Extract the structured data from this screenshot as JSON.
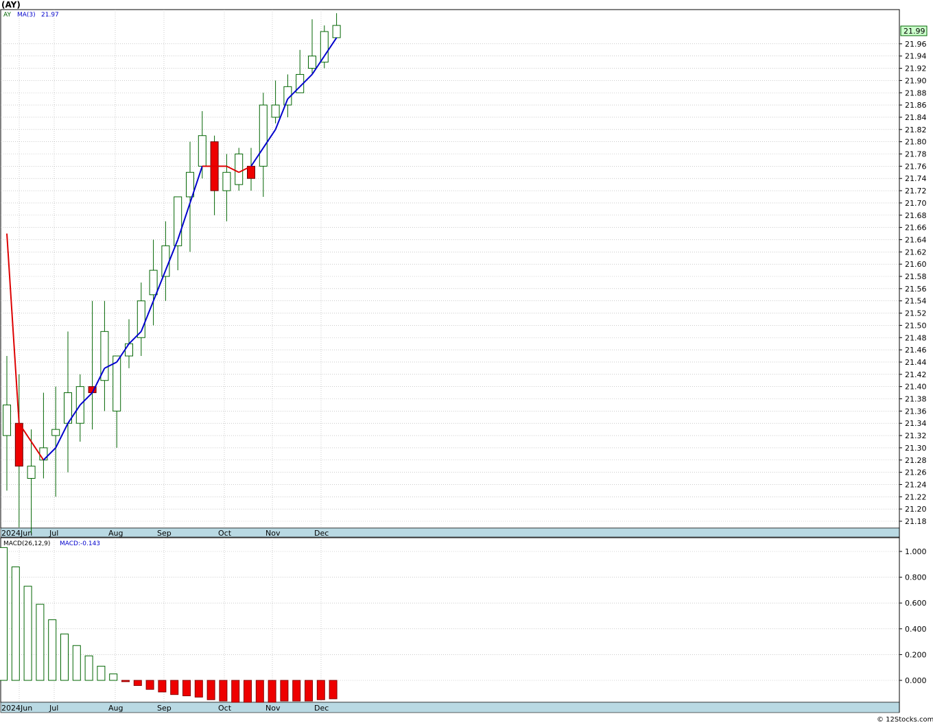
{
  "header": {
    "symbol_title": "(AY)",
    "legend_symbol": "AY",
    "legend_ma_label": "MA(3)",
    "legend_ma_value": "21.97",
    "last_price_tag": "21.99",
    "footer_credit": "© 12Stocks.com"
  },
  "macd_panel": {
    "label": "MACD(26,12,9)",
    "value_label": "MACD:-0.143"
  },
  "x_axis_labels": [
    "2024Jun",
    "Jul",
    "Aug",
    "Sep",
    "Oct",
    "Nov",
    "Dec"
  ],
  "colors": {
    "up_candle_edge": "#006400",
    "down_candle_fill": "#ee0000",
    "ma_up": "#0000cc",
    "ma_down": "#dd0000",
    "axis_band": "#b9d9e3",
    "grid": "#aaaaaa"
  },
  "chart_data": [
    {
      "type": "candlestick",
      "title": "(AY)",
      "ylim": [
        21.16,
        22.02
      ],
      "y_ticks": [
        "21.18",
        "21.20",
        "21.22",
        "21.24",
        "21.26",
        "21.28",
        "21.30",
        "21.32",
        "21.34",
        "21.36",
        "21.38",
        "21.40",
        "21.42",
        "21.44",
        "21.46",
        "21.48",
        "21.50",
        "21.52",
        "21.54",
        "21.56",
        "21.58",
        "21.60",
        "21.62",
        "21.64",
        "21.66",
        "21.68",
        "21.70",
        "21.72",
        "21.74",
        "21.76",
        "21.78",
        "21.80",
        "21.82",
        "21.84",
        "21.86",
        "21.88",
        "21.90",
        "21.92",
        "21.94",
        "21.96"
      ],
      "month_labels": [
        "2024Jun",
        "Jul",
        "Aug",
        "Sep",
        "Oct",
        "Nov",
        "Dec"
      ],
      "grid": true,
      "candles": [
        {
          "o": 21.32,
          "h": 21.45,
          "l": 21.23,
          "c": 21.37
        },
        {
          "o": 21.34,
          "h": 21.42,
          "l": 21.17,
          "c": 21.27
        },
        {
          "o": 21.25,
          "h": 21.33,
          "l": 21.16,
          "c": 21.27
        },
        {
          "o": 21.28,
          "h": 21.39,
          "l": 21.25,
          "c": 21.3
        },
        {
          "o": 21.32,
          "h": 21.4,
          "l": 21.22,
          "c": 21.33
        },
        {
          "o": 21.34,
          "h": 21.49,
          "l": 21.26,
          "c": 21.39
        },
        {
          "o": 21.34,
          "h": 21.42,
          "l": 21.31,
          "c": 21.4
        },
        {
          "o": 21.4,
          "h": 21.54,
          "l": 21.33,
          "c": 21.39
        },
        {
          "o": 21.41,
          "h": 21.54,
          "l": 21.36,
          "c": 21.49
        },
        {
          "o": 21.36,
          "h": 21.45,
          "l": 21.3,
          "c": 21.45
        },
        {
          "o": 21.45,
          "h": 21.51,
          "l": 21.43,
          "c": 21.47
        },
        {
          "o": 21.48,
          "h": 21.57,
          "l": 21.45,
          "c": 21.54
        },
        {
          "o": 21.55,
          "h": 21.64,
          "l": 21.5,
          "c": 21.59
        },
        {
          "o": 21.58,
          "h": 21.67,
          "l": 21.54,
          "c": 21.63
        },
        {
          "o": 21.63,
          "h": 21.71,
          "l": 21.59,
          "c": 21.71
        },
        {
          "o": 21.71,
          "h": 21.8,
          "l": 21.62,
          "c": 21.75
        },
        {
          "o": 21.76,
          "h": 21.85,
          "l": 21.74,
          "c": 21.81
        },
        {
          "o": 21.8,
          "h": 21.81,
          "l": 21.68,
          "c": 21.72
        },
        {
          "o": 21.72,
          "h": 21.78,
          "l": 21.67,
          "c": 21.75
        },
        {
          "o": 21.73,
          "h": 21.79,
          "l": 21.72,
          "c": 21.78
        },
        {
          "o": 21.76,
          "h": 21.79,
          "l": 21.72,
          "c": 21.74
        },
        {
          "o": 21.76,
          "h": 21.88,
          "l": 21.71,
          "c": 21.86
        },
        {
          "o": 21.84,
          "h": 21.9,
          "l": 21.83,
          "c": 21.86
        },
        {
          "o": 21.86,
          "h": 21.91,
          "l": 21.84,
          "c": 21.89
        },
        {
          "o": 21.88,
          "h": 21.95,
          "l": 21.88,
          "c": 21.91
        },
        {
          "o": 21.92,
          "h": 22.0,
          "l": 21.91,
          "c": 21.94
        },
        {
          "o": 21.93,
          "h": 21.99,
          "l": 21.92,
          "c": 21.98
        },
        {
          "o": 21.97,
          "h": 22.01,
          "l": 21.97,
          "c": 21.99
        }
      ],
      "ma3": [
        21.65,
        21.34,
        21.31,
        21.28,
        21.3,
        21.34,
        21.37,
        21.39,
        21.43,
        21.44,
        21.47,
        21.49,
        21.54,
        21.59,
        21.64,
        21.7,
        21.76,
        21.76,
        21.76,
        21.75,
        21.76,
        21.79,
        21.82,
        21.87,
        21.89,
        21.91,
        21.94,
        21.97
      ],
      "ma3_trend": [
        "down",
        "down",
        "down",
        "down",
        "up",
        "up",
        "up",
        "up",
        "up",
        "up",
        "up",
        "up",
        "up",
        "up",
        "up",
        "up",
        "up",
        "down",
        "down",
        "down",
        "down",
        "up",
        "up",
        "up",
        "up",
        "up",
        "up",
        "up"
      ]
    },
    {
      "type": "bar",
      "title": "MACD(26,12,9)",
      "ylim": [
        -0.17,
        1.05
      ],
      "y_ticks": [
        "1.000",
        "0.800",
        "0.600",
        "0.400",
        "0.200",
        "0.000"
      ],
      "month_labels": [
        "2024Jun",
        "Jul",
        "Aug",
        "Sep",
        "Oct",
        "Nov",
        "Dec"
      ],
      "values": [
        1.03,
        0.88,
        0.73,
        0.59,
        0.47,
        0.36,
        0.27,
        0.19,
        0.11,
        0.05,
        -0.01,
        -0.04,
        -0.07,
        -0.09,
        -0.11,
        -0.12,
        -0.13,
        -0.15,
        -0.16,
        -0.17,
        -0.17,
        -0.17,
        -0.17,
        -0.16,
        -0.16,
        -0.16,
        -0.15,
        -0.143
      ]
    }
  ]
}
